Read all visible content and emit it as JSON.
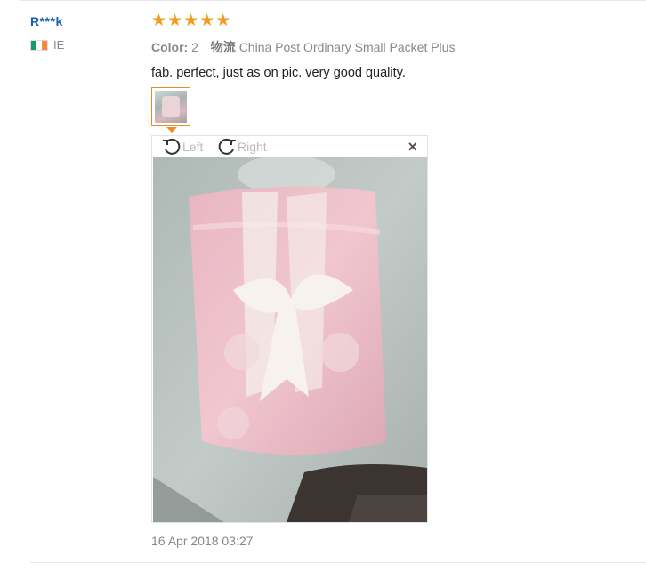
{
  "review": {
    "username": "R***k",
    "country_code": "IE",
    "flag_colors": [
      "#169b62",
      "#ffffff",
      "#ff883e"
    ],
    "rating": 5,
    "stars": [
      "★",
      "★",
      "★",
      "★",
      "★"
    ],
    "color_label": "Color:",
    "color_value": "2",
    "shipping_label": "物流",
    "shipping_value": "China Post Ordinary Small Packet Plus",
    "text": "fab. perfect, just as on pic. very good quality.",
    "date": "16 Apr 2018 03:27"
  },
  "viewer": {
    "rotate_left_label": "Left",
    "rotate_right_label": "Right",
    "close_symbol": "×"
  },
  "colors": {
    "accent_orange": "#ee8a1f",
    "star_color": "#f39a1f",
    "username_blue": "#1b5fa8"
  }
}
